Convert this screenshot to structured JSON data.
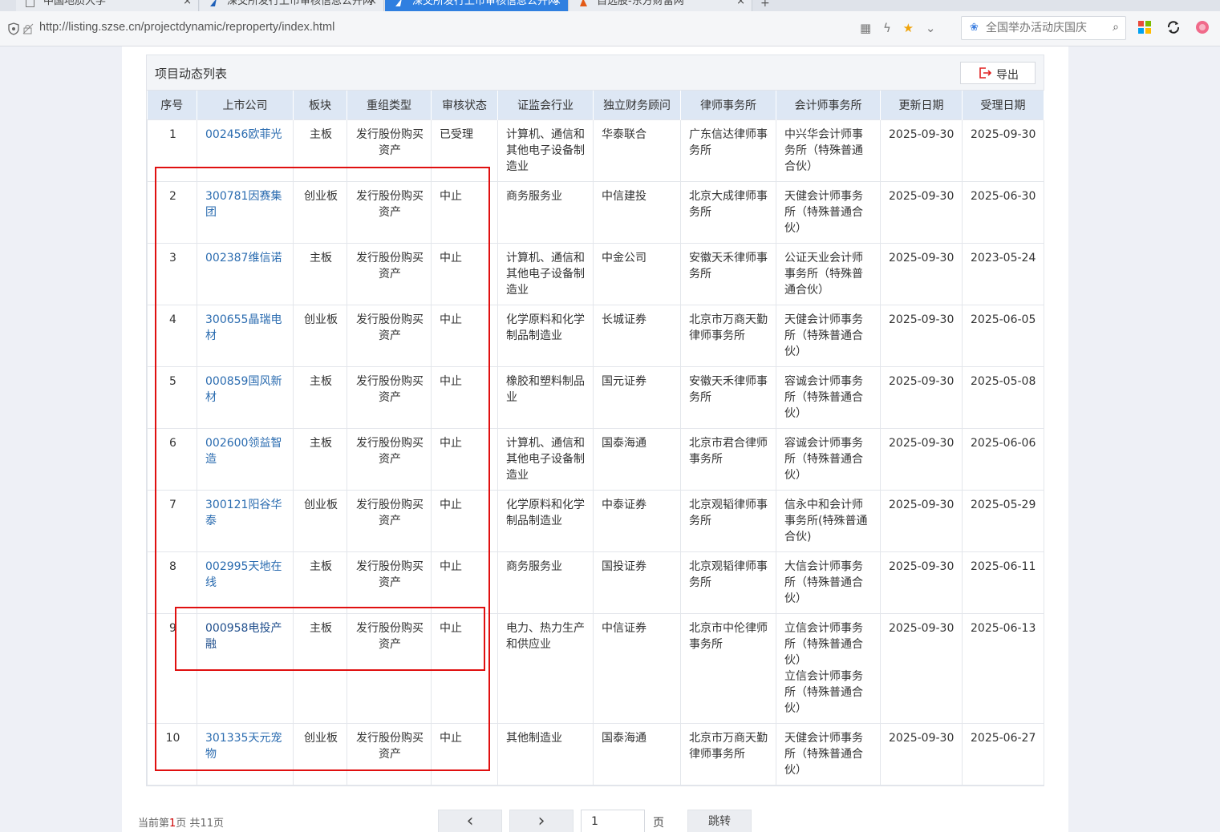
{
  "browser": {
    "tabs": [
      {
        "label": "中国地质大学",
        "close": "×",
        "active": false
      },
      {
        "label": "深交所发行上市审核信息公开网",
        "close": "×",
        "active": false
      },
      {
        "label": "深交所发行上市审核信息公开网",
        "close": "×",
        "active": true
      },
      {
        "label": "自选股-东方财富网",
        "close": "×",
        "active": false
      }
    ],
    "new_tab": "+",
    "url": "http://listing.szse.cn/projectdynamic/reproperty/index.html",
    "search_placeholder": "全国举办活动庆国庆"
  },
  "panel": {
    "title": "项目动态列表",
    "export_label": "导出"
  },
  "table": {
    "headers": [
      "序号",
      "上市公司",
      "板块",
      "重组类型",
      "审核状态",
      "证监会行业",
      "独立财务顾问",
      "律师事务所",
      "会计师事务所",
      "更新日期",
      "受理日期"
    ],
    "rows": [
      {
        "no": "1",
        "company": "002456欧菲光",
        "board": "主板",
        "type": "发行股份购买资产",
        "status": "已受理",
        "industry": "计算机、通信和其他电子设备制造业",
        "advisor": "华泰联合",
        "law": "广东信达律师事务所",
        "accounting": "中兴华会计师事务所（特殊普通合伙）",
        "updated": "2025-09-30",
        "accepted": "2025-09-30"
      },
      {
        "no": "2",
        "company": "300781因赛集团",
        "board": "创业板",
        "type": "发行股份购买资产",
        "status": "中止",
        "industry": "商务服务业",
        "advisor": "中信建投",
        "law": "北京大成律师事务所",
        "accounting": "天健会计师事务所（特殊普通合伙）",
        "updated": "2025-09-30",
        "accepted": "2025-06-30"
      },
      {
        "no": "3",
        "company": "002387维信诺",
        "board": "主板",
        "type": "发行股份购买资产",
        "status": "中止",
        "industry": "计算机、通信和其他电子设备制造业",
        "advisor": "中金公司",
        "law": "安徽天禾律师事务所",
        "accounting": "公证天业会计师事务所（特殊普通合伙）",
        "updated": "2025-09-30",
        "accepted": "2023-05-24"
      },
      {
        "no": "4",
        "company": "300655晶瑞电材",
        "board": "创业板",
        "type": "发行股份购买资产",
        "status": "中止",
        "industry": "化学原料和化学制品制造业",
        "advisor": "长城证券",
        "law": "北京市万商天勤律师事务所",
        "accounting": "天健会计师事务所（特殊普通合伙）",
        "updated": "2025-09-30",
        "accepted": "2025-06-05"
      },
      {
        "no": "5",
        "company": "000859国风新材",
        "board": "主板",
        "type": "发行股份购买资产",
        "status": "中止",
        "industry": "橡胶和塑料制品业",
        "advisor": "国元证券",
        "law": "安徽天禾律师事务所",
        "accounting": "容诚会计师事务所（特殊普通合伙）",
        "updated": "2025-09-30",
        "accepted": "2025-05-08"
      },
      {
        "no": "6",
        "company": "002600领益智造",
        "board": "主板",
        "type": "发行股份购买资产",
        "status": "中止",
        "industry": "计算机、通信和其他电子设备制造业",
        "advisor": "国泰海通",
        "law": "北京市君合律师事务所",
        "accounting": "容诚会计师事务所（特殊普通合伙）",
        "updated": "2025-09-30",
        "accepted": "2025-06-06"
      },
      {
        "no": "7",
        "company": "300121阳谷华泰",
        "board": "创业板",
        "type": "发行股份购买资产",
        "status": "中止",
        "industry": "化学原料和化学制品制造业",
        "advisor": "中泰证券",
        "law": "北京观韬律师事务所",
        "accounting": "信永中和会计师事务所(特殊普通合伙)",
        "updated": "2025-09-30",
        "accepted": "2025-05-29"
      },
      {
        "no": "8",
        "company": "002995天地在线",
        "board": "主板",
        "type": "发行股份购买资产",
        "status": "中止",
        "industry": "商务服务业",
        "advisor": "国投证券",
        "law": "北京观韬律师事务所",
        "accounting": "大信会计师事务所（特殊普通合伙）",
        "updated": "2025-09-30",
        "accepted": "2025-06-11"
      },
      {
        "no": "9",
        "company": "000958电投产融",
        "board": "主板",
        "type": "发行股份购买资产",
        "status": "中止",
        "industry": "电力、热力生产和供应业",
        "advisor": "中信证券",
        "law": "北京市中伦律师事务所",
        "accounting": "立信会计师事务所（特殊普通合伙）\n立信会计师事务所（特殊普通合伙）",
        "updated": "2025-09-30",
        "accepted": "2025-06-13"
      },
      {
        "no": "10",
        "company": "301335天元宠物",
        "board": "创业板",
        "type": "发行股份购买资产",
        "status": "中止",
        "industry": "其他制造业",
        "advisor": "国泰海通",
        "law": "北京市万商天勤律师事务所",
        "accounting": "天健会计师事务所（特殊普通合伙）",
        "updated": "2025-09-30",
        "accepted": "2025-06-27"
      }
    ]
  },
  "pager": {
    "prefix": "当前第",
    "current": "1",
    "middle": "页 共",
    "total": "11",
    "suffix": "页",
    "prev": "‹",
    "next": "›",
    "input_value": "1",
    "page_label": "页",
    "jump_label": "跳转"
  },
  "colors": {
    "active_tab": "#2f7fe0",
    "link": "#2b6cb0",
    "header_bg": "#dde7f4",
    "annotation": "#e01010"
  }
}
